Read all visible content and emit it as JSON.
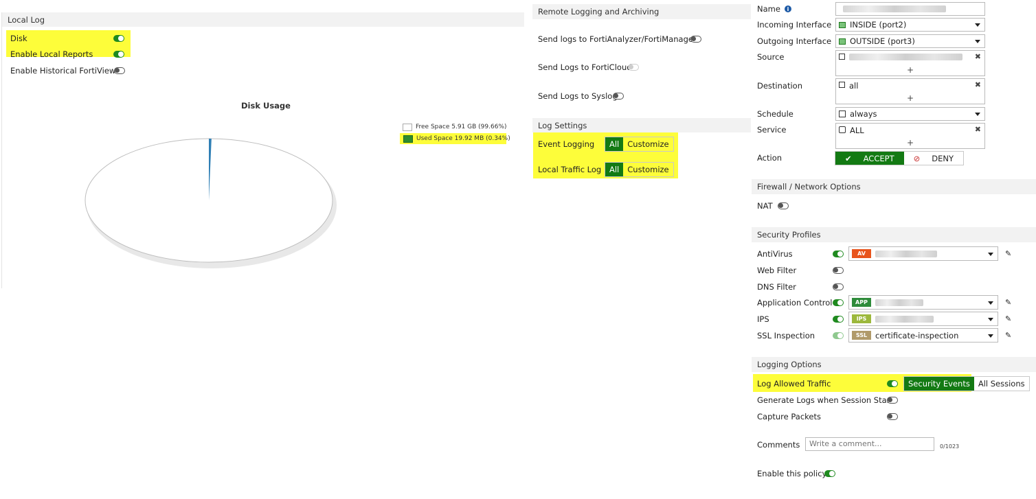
{
  "local_log": {
    "title": "Local Log",
    "disk_label": "Disk",
    "enable_local_reports_label": "Enable Local Reports",
    "enable_historical_fortiview_label": "Enable Historical FortiView",
    "disk_usage_title": "Disk Usage",
    "legend_free": "Free Space 5.91 GB (99.66%)",
    "legend_used": "Used Space 19.92 MB (0.34%)"
  },
  "chart_data": {
    "type": "pie",
    "title": "Disk Usage",
    "categories": [
      "Free Space 5.91 GB (99.66%)",
      "Used Space 19.92 MB (0.34%)"
    ],
    "values": [
      99.66,
      0.34
    ],
    "colors": [
      "#ffffff",
      "#2f7fb5"
    ],
    "legend_placement": "top-right"
  },
  "remote": {
    "title": "Remote Logging and Archiving",
    "fortianalyzer_label": "Send logs to FortiAnalyzer/FortiManager",
    "forticloud_label": "Send Logs to FortiCloud",
    "syslog_label": "Send Logs to Syslog"
  },
  "log_settings": {
    "title": "Log Settings",
    "event_logging_label": "Event Logging",
    "local_traffic_label": "Local Traffic Log",
    "all_label": "All",
    "customize_label": "Customize"
  },
  "policy": {
    "name_label": "Name",
    "incoming_label": "Incoming Interface",
    "incoming_value": "INSIDE (port2)",
    "outgoing_label": "Outgoing Interface",
    "outgoing_value": "OUTSIDE (port3)",
    "source_label": "Source",
    "destination_label": "Destination",
    "destination_value": "all",
    "schedule_label": "Schedule",
    "schedule_value": "always",
    "service_label": "Service",
    "service_value": "ALL",
    "action_label": "Action",
    "accept_label": "ACCEPT",
    "deny_label": "DENY",
    "plus": "+"
  },
  "firewall": {
    "title": "Firewall / Network Options",
    "nat_label": "NAT"
  },
  "security": {
    "title": "Security Profiles",
    "antivirus_label": "AntiVirus",
    "webfilter_label": "Web Filter",
    "dnsfilter_label": "DNS Filter",
    "appcontrol_label": "Application Control",
    "ips_label": "IPS",
    "ssl_label": "SSL Inspection",
    "av_tag": "AV",
    "app_tag": "APP",
    "ips_tag": "IPS",
    "ssl_tag": "SSL",
    "ssl_value": "certificate-inspection"
  },
  "logging_options": {
    "title": "Logging Options",
    "log_allowed_label": "Log Allowed Traffic",
    "security_events_label": "Security Events",
    "all_sessions_label": "All Sessions",
    "generate_logs_label": "Generate Logs when Session Starts",
    "capture_packets_label": "Capture Packets",
    "comments_label": "Comments",
    "comments_placeholder": "Write a comment...",
    "comments_counter": "0/1023",
    "enable_policy_label": "Enable this policy"
  }
}
